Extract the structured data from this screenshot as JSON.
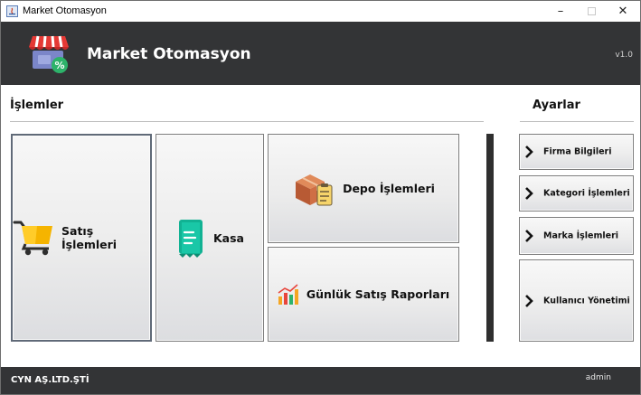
{
  "window": {
    "title": "Market Otomasyon",
    "minimize_glyph": "–",
    "close_glyph": "✕"
  },
  "header": {
    "app_title": "Market Otomasyon",
    "version": "v1.0",
    "logo_icon": "market-shop-icon"
  },
  "sections": {
    "islemler": "İşlemler",
    "ayarlar": "Ayarlar"
  },
  "tiles": {
    "satis": {
      "label": "Satış İşlemleri",
      "icon": "shopping-cart-icon"
    },
    "kasa": {
      "label": "Kasa",
      "icon": "receipt-icon"
    },
    "depo": {
      "label": "Depo İşlemleri",
      "icon": "box-clipboard-icon"
    },
    "raporlar": {
      "label": "Günlük Satış Raporları",
      "icon": "bar-chart-icon"
    }
  },
  "settings": [
    {
      "label": "Firma Bilgileri"
    },
    {
      "label": "Kategori İşlemleri"
    },
    {
      "label": "Marka İşlemleri"
    },
    {
      "label": "Kullanıcı Yönetimi"
    }
  ],
  "footer": {
    "company": "CYN AŞ.LTD.ŞTİ",
    "user": "admin"
  },
  "colors": {
    "header_bg": "#333436",
    "footer_bg": "#333436",
    "divider": "#2f2f2f"
  }
}
